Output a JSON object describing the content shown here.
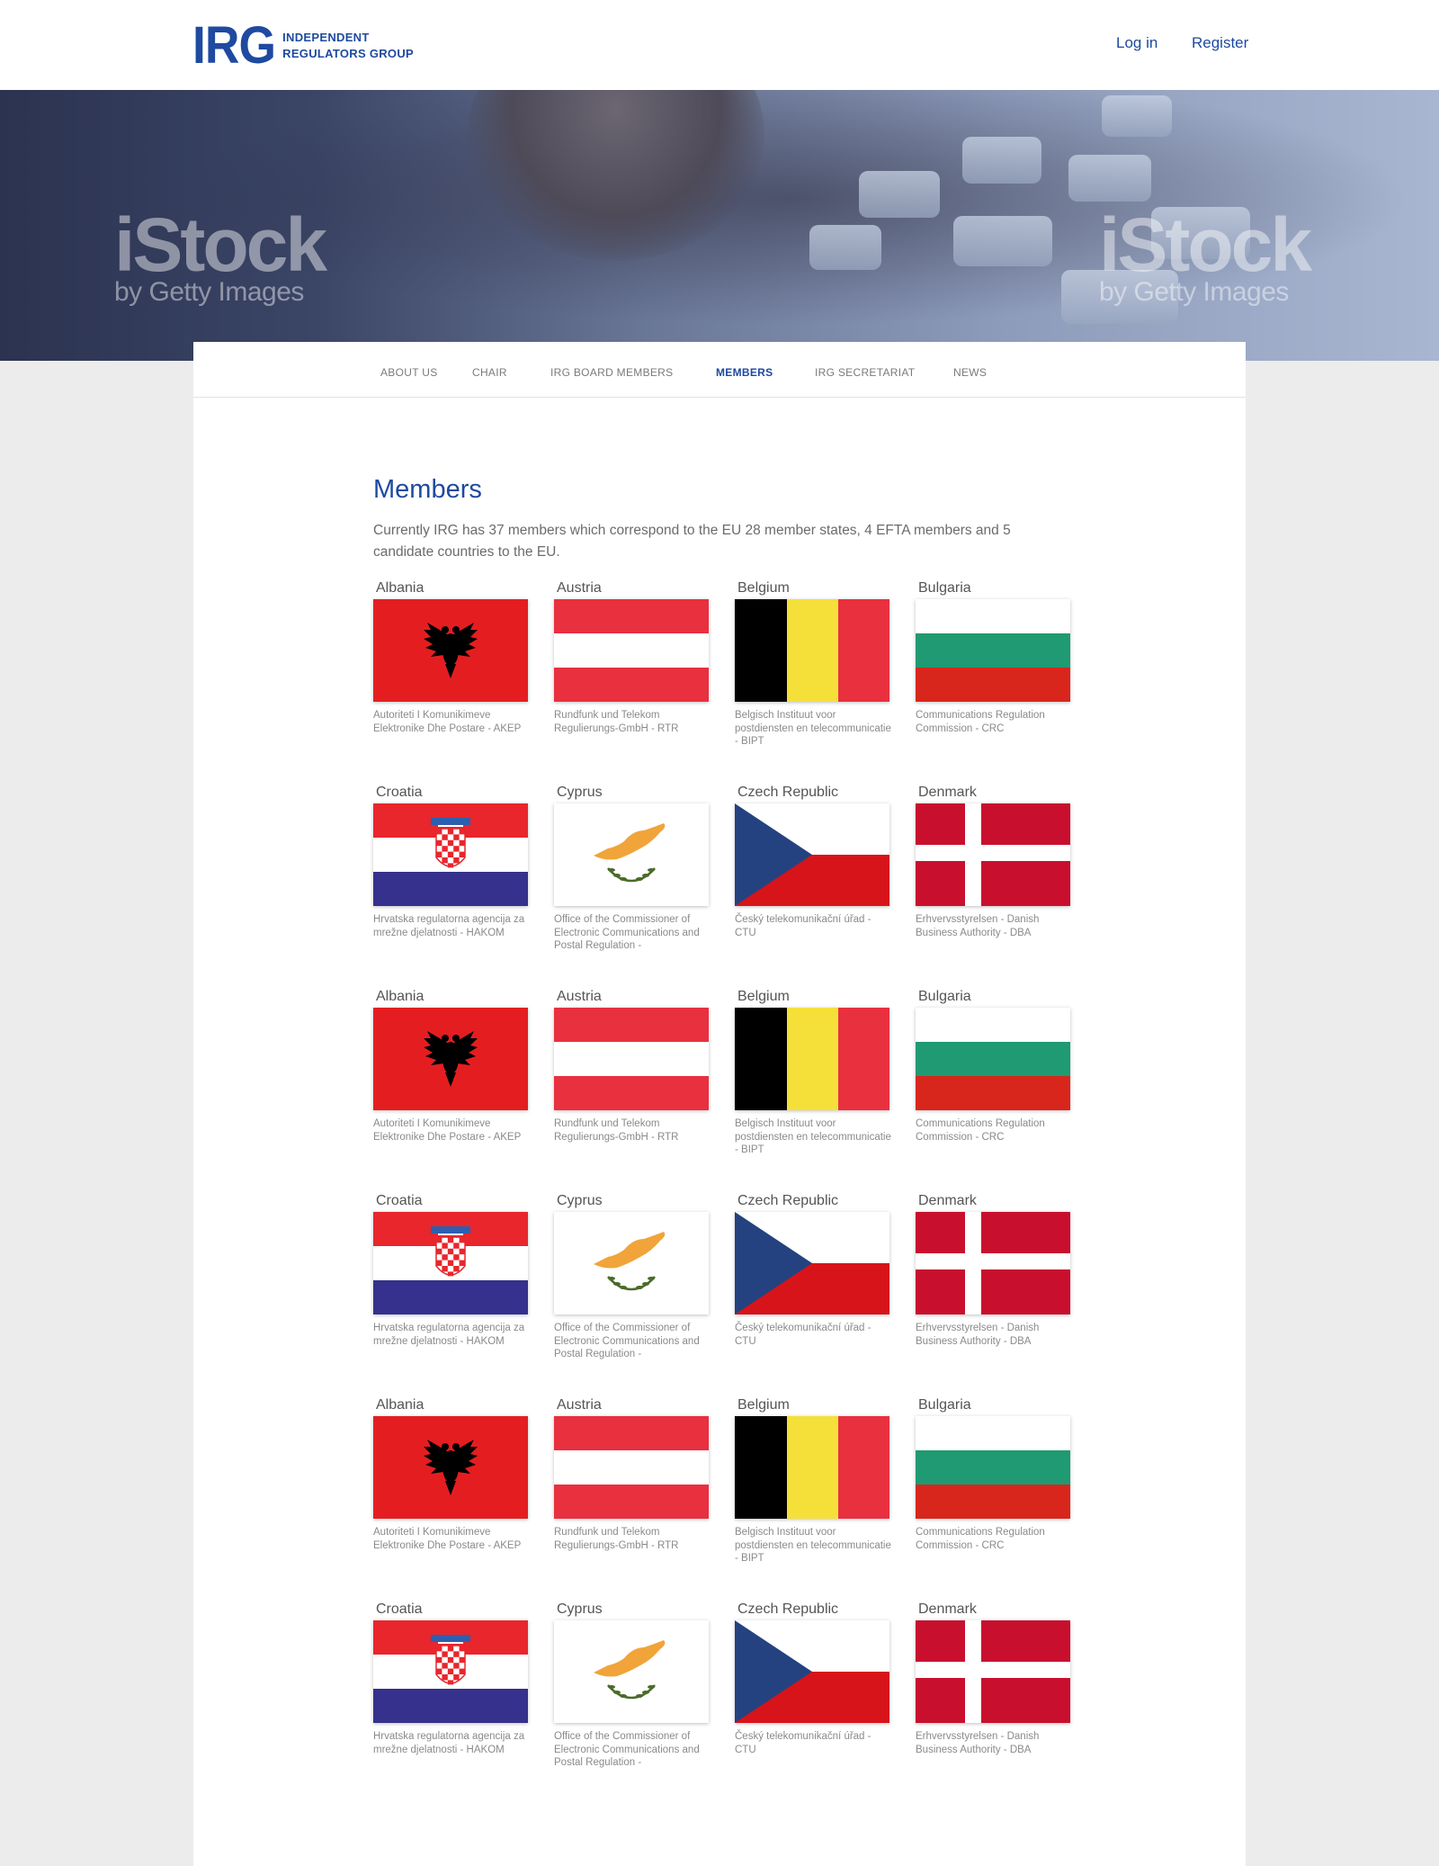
{
  "header": {
    "logo_mark": "IRG",
    "logo_line1": "INDEPENDENT",
    "logo_line2": "REGULATORS GROUP",
    "login_label": "Log in",
    "register_label": "Register"
  },
  "hero": {
    "watermark_big": "iStock",
    "watermark_small": "by Getty Images"
  },
  "nav": {
    "items": [
      "ABOUT US",
      "CHAIR",
      "IRG BOARD MEMBERS",
      "MEMBERS",
      "IRG SECRETARIAT",
      "NEWS"
    ],
    "active": "MEMBERS"
  },
  "page": {
    "title": "Members",
    "intro": "Currently IRG has 37 members which correspond to the EU 28 member states, 4 EFTA members and 5 candidate countries to the EU."
  },
  "members": [
    {
      "country": "Albania",
      "regulator": "Autoriteti I Komunikimeve Elektronike Dhe Postare - AKEP",
      "flag": "albania-flag"
    },
    {
      "country": "Austria",
      "regulator": "Rundfunk und Telekom Regulierungs-GmbH - RTR",
      "flag": "austria-flag"
    },
    {
      "country": "Belgium",
      "regulator": "Belgisch Instituut voor postdiensten en telecommunicatie - BIPT",
      "flag": "belgium-flag"
    },
    {
      "country": "Bulgaria",
      "regulator": "Communications Regulation Commission - CRC",
      "flag": "bulgaria-flag"
    },
    {
      "country": "Croatia",
      "regulator": "Hrvatska regulatorna agencija za mrežne djelatnosti - HAKOM",
      "flag": "croatia-flag"
    },
    {
      "country": "Cyprus",
      "regulator": "Office of the Commissioner of Electronic Communications and Postal Regulation -",
      "flag": "cyprus-flag"
    },
    {
      "country": "Czech Republic",
      "regulator": "Český telekomunikační úřad - CTU",
      "flag": "czech-flag"
    },
    {
      "country": "Denmark",
      "regulator": "Erhvervsstyrelsen - Danish Business Authority - DBA",
      "flag": "denmark-flag"
    },
    {
      "country": "Albania",
      "regulator": "Autoriteti I Komunikimeve Elektronike Dhe Postare - AKEP",
      "flag": "albania-flag"
    },
    {
      "country": "Austria",
      "regulator": "Rundfunk und Telekom Regulierungs-GmbH - RTR",
      "flag": "austria-flag"
    },
    {
      "country": "Belgium",
      "regulator": "Belgisch Instituut voor postdiensten en telecommunicatie - BIPT",
      "flag": "belgium-flag"
    },
    {
      "country": "Bulgaria",
      "regulator": "Communications Regulation Commission - CRC",
      "flag": "bulgaria-flag"
    },
    {
      "country": "Croatia",
      "regulator": "Hrvatska regulatorna agencija za mrežne djelatnosti - HAKOM",
      "flag": "croatia-flag"
    },
    {
      "country": "Cyprus",
      "regulator": "Office of the Commissioner of Electronic Communications and Postal Regulation -",
      "flag": "cyprus-flag"
    },
    {
      "country": "Czech Republic",
      "regulator": "Český telekomunikační úřad - CTU",
      "flag": "czech-flag"
    },
    {
      "country": "Denmark",
      "regulator": "Erhvervsstyrelsen - Danish Business Authority - DBA",
      "flag": "denmark-flag"
    },
    {
      "country": "Albania",
      "regulator": "Autoriteti I Komunikimeve Elektronike Dhe Postare - AKEP",
      "flag": "albania-flag"
    },
    {
      "country": "Austria",
      "regulator": "Rundfunk und Telekom Regulierungs-GmbH - RTR",
      "flag": "austria-flag"
    },
    {
      "country": "Belgium",
      "regulator": "Belgisch Instituut voor postdiensten en telecommunicatie - BIPT",
      "flag": "belgium-flag"
    },
    {
      "country": "Bulgaria",
      "regulator": "Communications Regulation Commission - CRC",
      "flag": "bulgaria-flag"
    },
    {
      "country": "Croatia",
      "regulator": "Hrvatska regulatorna agencija za mrežne djelatnosti - HAKOM",
      "flag": "croatia-flag"
    },
    {
      "country": "Cyprus",
      "regulator": "Office of the Commissioner of Electronic Communications and Postal Regulation -",
      "flag": "cyprus-flag"
    },
    {
      "country": "Czech Republic",
      "regulator": "Český telekomunikační úřad - CTU",
      "flag": "czech-flag"
    },
    {
      "country": "Denmark",
      "regulator": "Erhvervsstyrelsen - Danish Business Authority - DBA",
      "flag": "denmark-flag"
    }
  ],
  "colors": {
    "brand_blue": "#1e4aa0",
    "page_bg": "#ececec"
  }
}
